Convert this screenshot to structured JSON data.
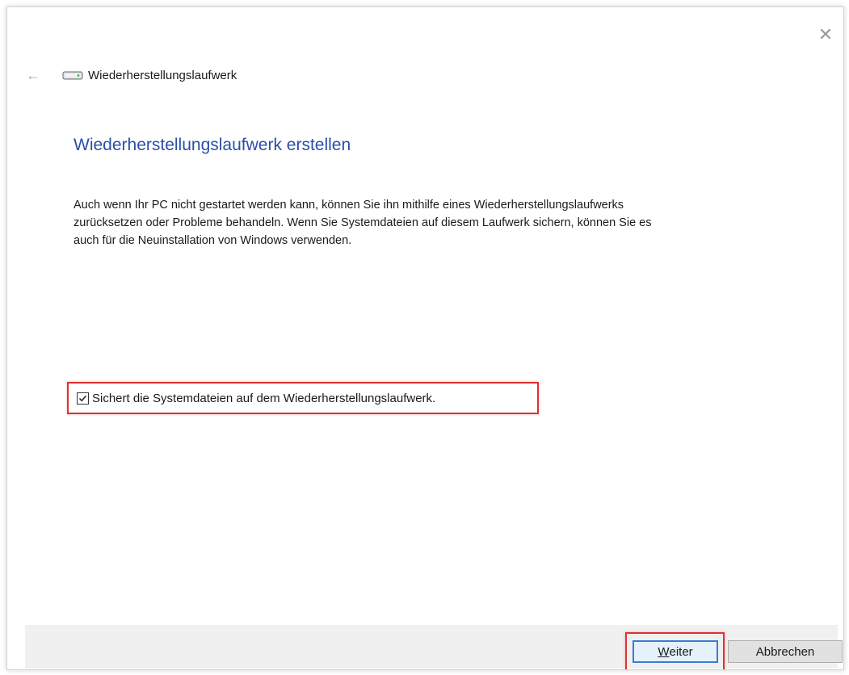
{
  "window": {
    "close_glyph": "✕"
  },
  "nav": {
    "back_glyph": "←",
    "title": "Wiederherstellungslaufwerk"
  },
  "page": {
    "title": "Wiederherstellungslaufwerk erstellen",
    "description_lines": [
      "Auch wenn Ihr PC nicht gestartet werden kann, können Sie ihn mithilfe eines Wiederherstellungslaufwerks",
      "zurücksetzen oder Probleme behandeln. Wenn Sie Systemdateien auf diesem Laufwerk sichern, können Sie es",
      "auch für die Neuinstallation von Windows verwenden."
    ]
  },
  "backup_option": {
    "label": "Sichert die Systemdateien auf dem Wiederherstellungslaufwerk.",
    "checked": true
  },
  "buttons": {
    "next_accel": "W",
    "next_rest": "eiter",
    "cancel": "Abbrechen"
  },
  "icons": {
    "back": "back-arrow-icon",
    "drive": "drive-icon",
    "close": "close-icon",
    "check": "checkmark-icon"
  },
  "colors": {
    "title": "#2b4fa8",
    "highlight": "#e03131",
    "default_button_border": "#3d7ad6",
    "footer_bg": "#f0f0f0"
  }
}
